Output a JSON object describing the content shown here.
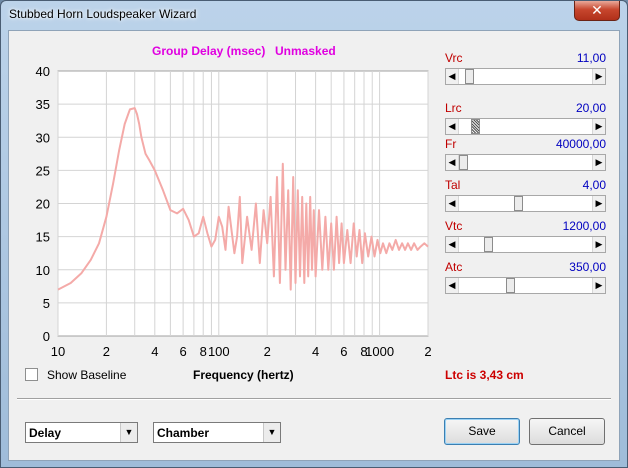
{
  "window": {
    "title": "Stubbed Horn Loudspeaker Wizard",
    "close_glyph": "✕"
  },
  "chart": {
    "title_left": "Group Delay (msec)",
    "title_right": "Unmasked",
    "xlabel": "Frequency (hertz)",
    "line_color": "#f4aaa8"
  },
  "chart_data": {
    "type": "line",
    "title": "Group Delay (msec)",
    "xlabel": "Frequency (hertz)",
    "ylabel": "",
    "xscale": "log",
    "xlim": [
      10,
      2000
    ],
    "ylim": [
      0,
      40
    ],
    "grid": true,
    "x_tick_labels": [
      "10",
      "2",
      "4",
      "6",
      "8",
      "100",
      "2",
      "4",
      "6",
      "8",
      "1000",
      "2"
    ],
    "y_tick_labels": [
      "0",
      "5",
      "10",
      "15",
      "20",
      "25",
      "30",
      "35",
      "40"
    ],
    "series": [
      {
        "x": [
          10,
          12,
          14,
          16,
          18,
          20,
          22,
          24,
          26,
          28,
          30,
          31,
          32,
          33,
          35,
          37,
          40,
          45,
          50,
          55,
          60,
          65,
          70,
          75,
          80,
          85,
          90,
          95,
          100,
          105,
          110,
          115,
          120,
          125,
          130,
          135,
          140,
          150,
          160,
          170,
          180,
          190,
          200,
          210,
          220,
          230,
          240,
          250,
          260,
          270,
          280,
          290,
          300,
          310,
          320,
          330,
          340,
          350,
          360,
          370,
          380,
          390,
          400,
          420,
          440,
          460,
          480,
          500,
          520,
          540,
          560,
          580,
          600,
          630,
          660,
          690,
          720,
          750,
          780,
          810,
          850,
          890,
          930,
          970,
          1010,
          1050,
          1100,
          1150,
          1200,
          1260,
          1320,
          1380,
          1440,
          1500,
          1570,
          1640,
          1720,
          1800,
          1900,
          2000
        ],
        "y": [
          7,
          8,
          9.5,
          11.5,
          14,
          18,
          23,
          28,
          32,
          34.2,
          34.4,
          33.5,
          32,
          30,
          27.5,
          26.5,
          25,
          22,
          19,
          18.5,
          19.2,
          17.5,
          15,
          15.5,
          18,
          15.5,
          13.5,
          14.5,
          18,
          16.5,
          13,
          19.5,
          16,
          12.5,
          15,
          21,
          11,
          18,
          13,
          20,
          11,
          19,
          14,
          21,
          9,
          24,
          8,
          26,
          10,
          22,
          7,
          24,
          8,
          22,
          9,
          21,
          8,
          20,
          9,
          21,
          10,
          19,
          9,
          19,
          10,
          18,
          10,
          17,
          10,
          18,
          11,
          17,
          11,
          16,
          11,
          17,
          12,
          16,
          11,
          15.5,
          12,
          15,
          12,
          14.5,
          12.5,
          14,
          12.5,
          14,
          13,
          14.5,
          13,
          14,
          13,
          14,
          13,
          14,
          13,
          13.5,
          14,
          13.5
        ]
      }
    ]
  },
  "options": {
    "show_baseline_label": "Show Baseline",
    "show_baseline_checked": false
  },
  "status_text": "Ltc is 3,43 cm",
  "sliders": [
    {
      "label": "Vrc",
      "value": "11,00",
      "position": 0.05
    },
    {
      "label": "Lrc",
      "value": "20,00",
      "position": 0.1,
      "focused": true
    },
    {
      "label": "Fr",
      "value": "40000,00",
      "position": 0.0
    },
    {
      "label": "Tal",
      "value": "4,00",
      "position": 0.44
    },
    {
      "label": "Vtc",
      "value": "1200,00",
      "position": 0.2
    },
    {
      "label": "Atc",
      "value": "350,00",
      "position": 0.38
    }
  ],
  "combos": [
    {
      "selected": "Delay"
    },
    {
      "selected": "Chamber"
    }
  ],
  "buttons": {
    "save": "Save",
    "cancel": "Cancel"
  },
  "glyphs": {
    "arrow_left": "◀",
    "arrow_right": "▶",
    "arrow_down": "▼"
  }
}
